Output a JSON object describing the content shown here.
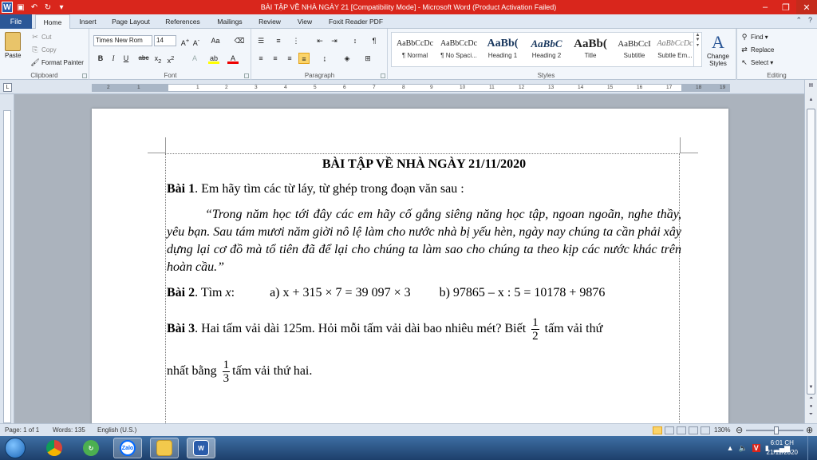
{
  "window": {
    "title": "BÀI TẬP VỀ NHÀ NGÀY 21 [Compatibility Mode] - Microsoft Word (Product Activation Failed)"
  },
  "tabs": [
    "File",
    "Home",
    "Insert",
    "Page Layout",
    "References",
    "Mailings",
    "Review",
    "View",
    "Foxit Reader PDF"
  ],
  "active_tab": "Home",
  "ribbon": {
    "clipboard": {
      "paste": "Paste",
      "cut": "Cut",
      "copy": "Copy",
      "format_painter": "Format Painter",
      "label": "Clipboard"
    },
    "font": {
      "name": "Times New Rom",
      "size": "14",
      "label": "Font"
    },
    "paragraph": {
      "label": "Paragraph"
    },
    "styles": {
      "label": "Styles",
      "items": [
        {
          "sample": "AaBbCcDc",
          "name": "¶ Normal"
        },
        {
          "sample": "AaBbCcDc",
          "name": "¶ No Spaci..."
        },
        {
          "sample": "AaBb(",
          "name": "Heading 1"
        },
        {
          "sample": "AaBbC",
          "name": "Heading 2"
        },
        {
          "sample": "AaBb(",
          "name": "Title"
        },
        {
          "sample": "AaBbCcI",
          "name": "Subtitle"
        },
        {
          "sample": "AaBbCcDc",
          "name": "Subtle Em..."
        }
      ],
      "change_styles": "Change Styles"
    },
    "editing": {
      "find": "Find",
      "replace": "Replace",
      "select": "Select",
      "label": "Editing"
    }
  },
  "ruler_numbers": [
    "2",
    "1",
    "",
    "1",
    "2",
    "3",
    "4",
    "5",
    "6",
    "7",
    "8",
    "9",
    "10",
    "11",
    "12",
    "13",
    "14",
    "15",
    "16",
    "17",
    "18",
    "19"
  ],
  "document": {
    "title": "BÀI TẬP VỀ NHÀ NGÀY 21/11/2020",
    "bai1_label": "Bài 1",
    "bai1_text": ". Em hãy tìm các từ láy, từ ghép trong đoạn văn sau :",
    "quote": "“Trong năm học tới đây các em hãy cố gắng siêng năng học tập, ngoan ngoãn, nghe thầy, yêu bạn. Sau tám mươi năm giời nô lệ làm cho nước nhà bị yếu hèn, ngày nay chúng ta cần phải xây dựng lại cơ đồ mà tổ tiên đã để lại cho chúng ta làm sao cho chúng ta theo kịp các nước khác trên hoàn cầu.”",
    "bai2_label": "Bài 2",
    "bai2_intro": ". Tìm ",
    "bai2_var": "x",
    "bai2_colon": ":",
    "bai2_a": "a) x + 315 × 7 = 39 097 × 3",
    "bai2_b": "b) 97865 – x : 5 = 10178 + 9876",
    "bai3_label": "Bài 3",
    "bai3_text": ". Hai tấm vải dài 125m. Hỏi mỗi tấm vải dài bao nhiêu mét? Biết",
    "frac1_num": "1",
    "frac1_den": "2",
    "bai3_text2": "tấm vải thứ",
    "bai3_line2a": "nhất bằng",
    "frac2_num": "1",
    "frac2_den": "3",
    "bai3_line2b": "tấm vải thứ hai."
  },
  "status": {
    "page": "Page: 1 of 1",
    "words": "Words: 135",
    "language": "English (U.S.)",
    "zoom": "130%"
  },
  "taskbar": {
    "apps": [
      "Chrome",
      "Zalo settings",
      "Zalo",
      "File Explorer",
      "Word"
    ],
    "active_app": "Word",
    "time": "6:01 CH",
    "date": "21/11/2020"
  }
}
